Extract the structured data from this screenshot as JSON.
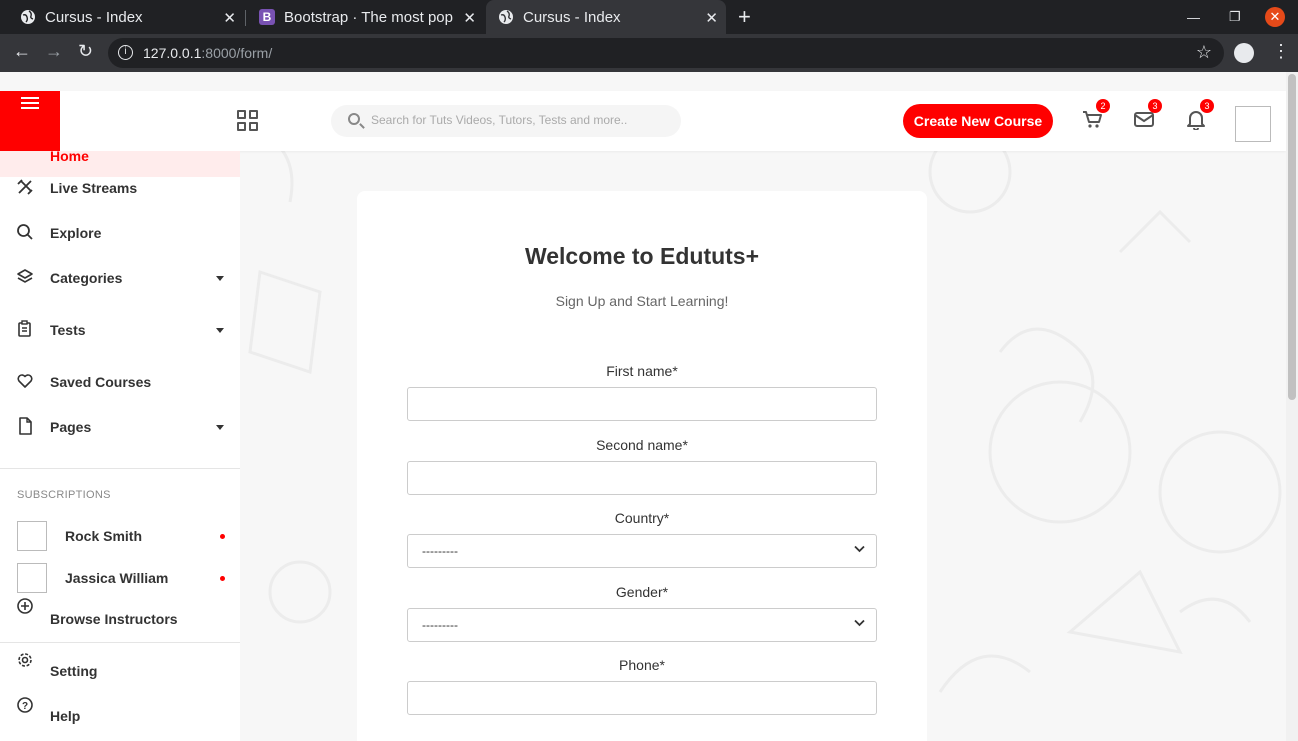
{
  "browser": {
    "tabs": [
      {
        "title": "Cursus - Index"
      },
      {
        "title": "Bootstrap · The most pop"
      },
      {
        "title": "Cursus - Index"
      }
    ],
    "url_host": "127.0.0.1",
    "url_path": ":8000/form/"
  },
  "header": {
    "search_placeholder": "Search for Tuts Videos, Tutors, Tests and more..",
    "create_button": "Create New Course",
    "cart_badge": "2",
    "mail_badge": "3",
    "bell_badge": "3"
  },
  "sidebar": {
    "home": "Home",
    "items": [
      {
        "label": "Live Streams",
        "icon": "live-streams-icon"
      },
      {
        "label": "Explore",
        "icon": "search-icon"
      },
      {
        "label": "Categories",
        "icon": "layers-icon"
      },
      {
        "label": "Tests",
        "icon": "clipboard-icon"
      },
      {
        "label": "Saved Courses",
        "icon": "heart-icon"
      },
      {
        "label": "Pages",
        "icon": "file-icon"
      }
    ],
    "subscriptions_heading": "SUBSCRIPTIONS",
    "subscriptions": [
      {
        "name": "Rock Smith"
      },
      {
        "name": "Jassica William"
      }
    ],
    "browse": "Browse Instructors",
    "setting": "Setting",
    "help": "Help"
  },
  "form": {
    "title": "Welcome to Edututs+",
    "subtitle": "Sign Up and Start Learning!",
    "first_name_label": "First name*",
    "second_name_label": "Second name*",
    "country_label": "Country*",
    "country_value": "---------",
    "gender_label": "Gender*",
    "gender_value": "---------",
    "phone_label": "Phone*"
  },
  "colors": {
    "accent": "#ff0000"
  }
}
